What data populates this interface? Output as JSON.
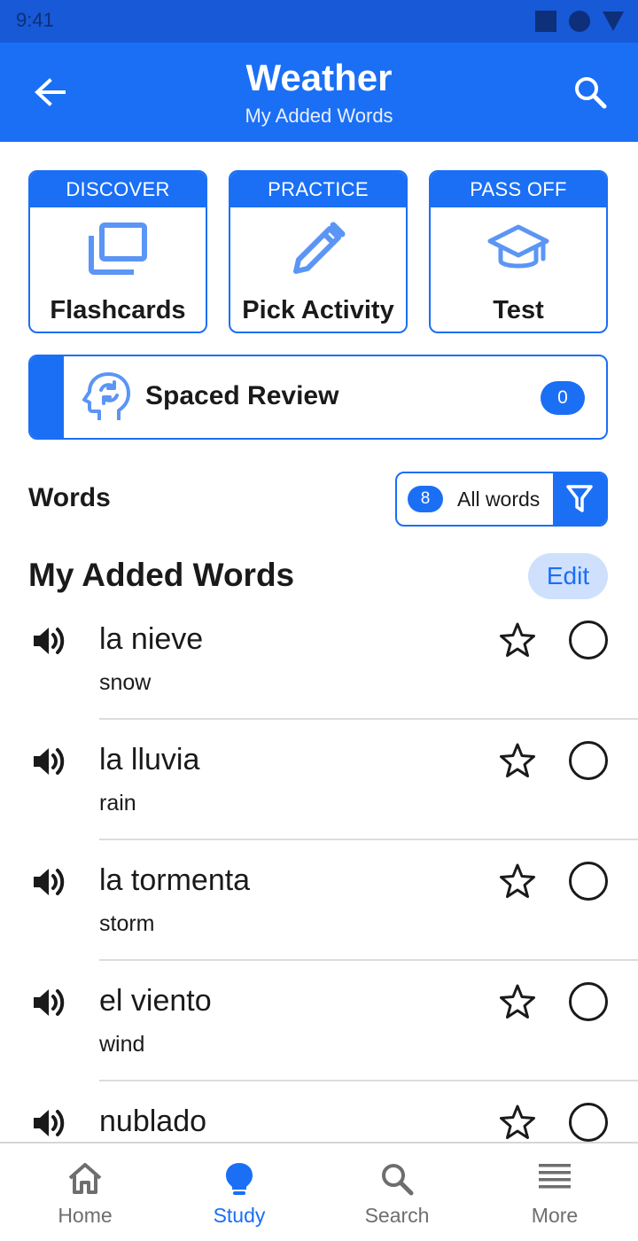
{
  "status_bar": {
    "time": "9:41"
  },
  "app_bar": {
    "title": "Weather",
    "subtitle": "My Added Words"
  },
  "modes": [
    {
      "header": "DISCOVER",
      "label": "Flashcards",
      "icon": "flashcards-icon"
    },
    {
      "header": "PRACTICE",
      "label": "Pick Activity",
      "icon": "pencil-icon"
    },
    {
      "header": "PASS OFF",
      "label": "Test",
      "icon": "graduation-cap-icon"
    }
  ],
  "spaced_review": {
    "label": "Spaced Review",
    "count": "0"
  },
  "words_section": {
    "label": "Words",
    "filter_count": "8",
    "filter_text": "All words"
  },
  "list": {
    "title": "My Added Words",
    "edit_label": "Edit"
  },
  "words": [
    {
      "term": "la nieve",
      "definition": "snow"
    },
    {
      "term": "la lluvia",
      "definition": "rain"
    },
    {
      "term": "la tormenta",
      "definition": "storm"
    },
    {
      "term": "el viento",
      "definition": "wind"
    },
    {
      "term": "nublado",
      "definition": ""
    }
  ],
  "bottom_nav": {
    "items": [
      {
        "label": "Home",
        "icon": "home-icon",
        "active": false
      },
      {
        "label": "Study",
        "icon": "lightbulb-icon",
        "active": true
      },
      {
        "label": "Search",
        "icon": "search-icon",
        "active": false
      },
      {
        "label": "More",
        "icon": "menu-icon",
        "active": false
      }
    ]
  },
  "colors": {
    "primary": "#1a6ff5",
    "status_bar": "#1759d6",
    "edit_bg": "#cfe0fc",
    "text": "#1a1a1a",
    "muted": "#6e6e6e"
  }
}
